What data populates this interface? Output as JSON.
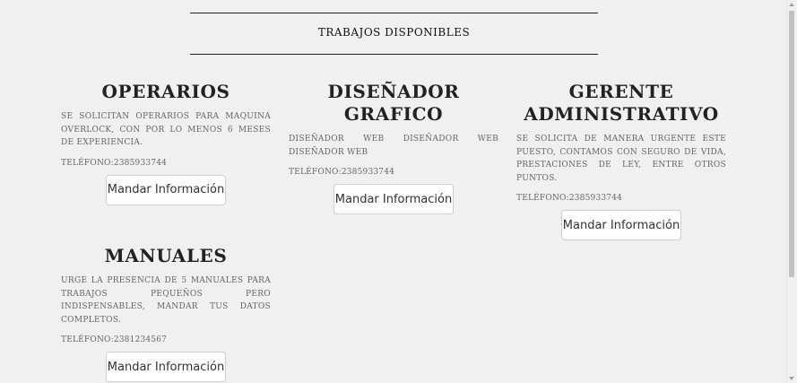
{
  "section": {
    "title": "TRABAJOS DISPONIBLES"
  },
  "jobs": [
    {
      "title": "OPERARIOS",
      "description": "SE SOLICITAN OPERARIOS PARA MAQUINA OVERLOCK, CON POR LO MENOS 6 MESES DE EXPERIENCIA.",
      "phone": "TELÉFONO:2385933744",
      "button_label": "Mandar Información"
    },
    {
      "title": "DISEÑADOR GRAFICO",
      "description": "DISEÑADOR WEB DISEÑADOR WEB DISEÑADOR WEB",
      "phone": "TELÉFONO:2385933744",
      "button_label": "Mandar Información"
    },
    {
      "title": "GERENTE ADMINISTRATIVO",
      "description": "SE SOLICITA DE MANERA URGENTE ESTE PUESTO, CONTAMOS CON SEGURO DE VIDA, PRESTACIONES DE LEY, ENTRE OTROS PUNTOS.",
      "phone": "TELÉFONO:2385933744",
      "button_label": "Mandar Información"
    },
    {
      "title": "MANUALES",
      "description": "URGE LA PRESENCIA DE 5 MANUALES PARA TRABAJOS PEQUEÑOS PERO INDISPENSABLES, MANDAR TUS DATOS COMPLETOS.",
      "phone": "TELÉFONO:2381234567",
      "button_label": "Mandar Información"
    }
  ],
  "colors": {
    "background": "#f0f0f0",
    "button_bg": "#ffffff",
    "rule": "#222222"
  }
}
